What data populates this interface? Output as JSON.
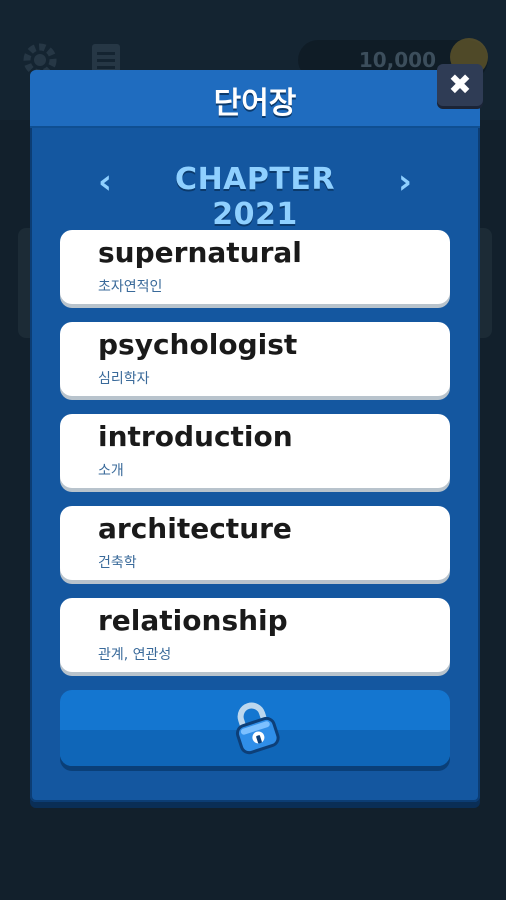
{
  "modal": {
    "title": "단어장",
    "close_label": "✖",
    "chapter": {
      "label": "CHAPTER 2021",
      "prev_glyph": "‹",
      "next_glyph": "›"
    },
    "words": [
      {
        "word": "supernatural",
        "meaning": "초자연적인"
      },
      {
        "word": "psychologist",
        "meaning": "심리학자"
      },
      {
        "word": "introduction",
        "meaning": "소개"
      },
      {
        "word": "architecture",
        "meaning": "건축학"
      },
      {
        "word": "relationship",
        "meaning": "관계, 연관성"
      }
    ],
    "lock_button_icon": "padlock-icon"
  },
  "background": {
    "coins": "10,000",
    "icons": [
      "gear-icon",
      "list-icon",
      "coin-icon"
    ]
  },
  "colors": {
    "modal_bg": "#1457a0",
    "header_bg": "#1f6cbf",
    "chapter_text": "#8fd0ff",
    "card_bg": "#ffffff",
    "meaning_text": "#3a6a9a",
    "lock_button": "#1476d0"
  }
}
